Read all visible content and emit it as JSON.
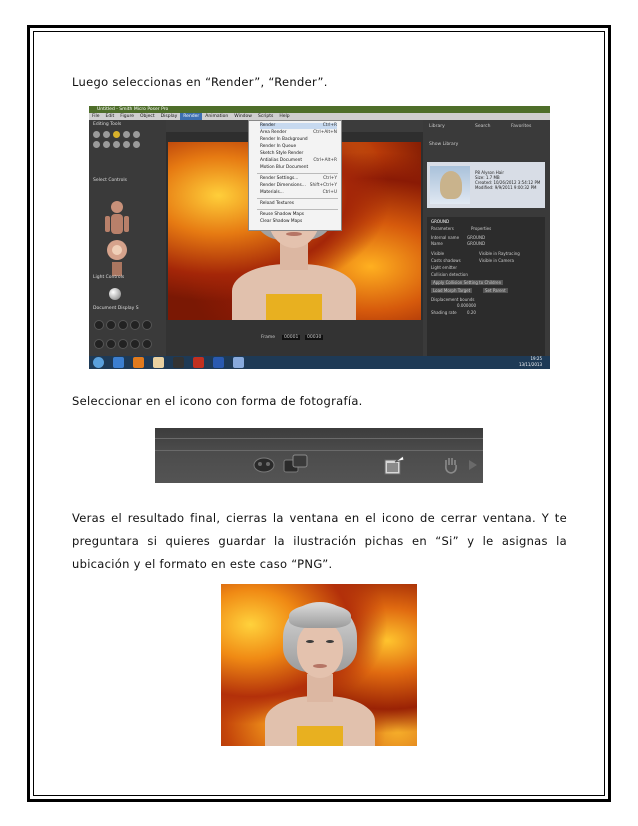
{
  "paragraphs": {
    "p1": "Luego seleccionas en “Render”,  “Render”.",
    "p2": "Seleccionar en el icono con forma de fotografía.",
    "p3": "Veras el resultado final, cierras la ventana en el icono de cerrar ventana. Y te preguntara si quieres guardar la ilustración pichas en “Si” y le asignas la ubicación y el formato en este caso “PNG”."
  },
  "poser": {
    "title": "Untitled - Smith Micro Poser Pro",
    "menubar": [
      "File",
      "Edit",
      "Figure",
      "Object",
      "Display",
      "Render",
      "Animation",
      "Window",
      "Scripts",
      "Help"
    ],
    "active_menu": "Render",
    "left_labels": [
      "Editing Tools",
      "Select Controls",
      "Light Controls",
      "Document Display S"
    ],
    "render_menu": [
      {
        "label": "Render",
        "shortcut": "Ctrl+R"
      },
      {
        "label": "Area Render",
        "shortcut": "Ctrl+Alt+N"
      },
      {
        "label": "Render In Background",
        "shortcut": ""
      },
      {
        "label": "Render In Queue",
        "shortcut": ""
      },
      {
        "label": "Sketch Style Render",
        "shortcut": ""
      },
      {
        "label": "Antialias Document",
        "shortcut": "Ctrl+Alt+R"
      },
      {
        "label": "Motion Blur Document",
        "shortcut": ""
      },
      {
        "label": "Render Settings...",
        "shortcut": "Ctrl+Y"
      },
      {
        "label": "Render Dimensions...",
        "shortcut": "Shift+Ctrl+Y"
      },
      {
        "label": "Materials...",
        "shortcut": "Ctrl+U"
      },
      {
        "label": "Reload Textures",
        "shortcut": ""
      },
      {
        "label": "Reuse Shadow Maps",
        "shortcut": ""
      },
      {
        "label": "Clear Shadow Maps",
        "shortcut": ""
      }
    ],
    "frame_label": "Frame",
    "frame_values": [
      "00001",
      "00030"
    ],
    "library": {
      "tabs": [
        "Library",
        "Search",
        "Favorites"
      ],
      "filter": "Show Library",
      "item_name": "P8 Alyson Hair",
      "item_info": [
        "Size: 1.7 MB",
        "Created: 10/26/2012 3:54:12 PM",
        "Modified: 9/9/2011 9:00:32 PM"
      ]
    },
    "props": {
      "header": "GROUND",
      "tabs": [
        "Parameters",
        "Properties"
      ],
      "internal_name_label": "Internal name",
      "internal_name": "GROUND",
      "name_label": "Name",
      "name": "GROUND",
      "checks": [
        "Visible",
        "Visible in Raytracing",
        "Casts shadows",
        "Visible in Camera",
        "Light emitter",
        "Collision detection"
      ],
      "buttons": [
        "Apply Collision Setting to Children",
        "Load Morph Target",
        "Set Parent"
      ],
      "displacement_label": "Displacement bounds",
      "displacement_value": "0.000000",
      "shading_label": "Shading rate",
      "shading_value": "0.20"
    },
    "taskbar_time": "19:25",
    "taskbar_date": "13/11/2013"
  }
}
